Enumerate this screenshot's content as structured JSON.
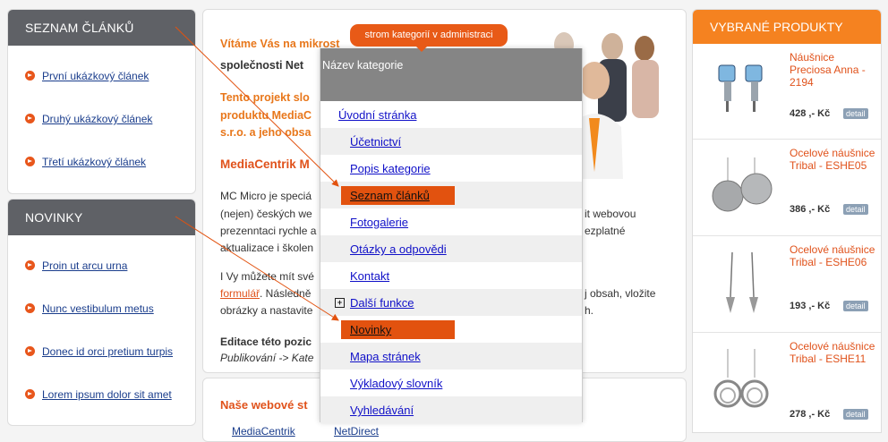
{
  "left": {
    "articles": {
      "title": "SEZNAM ČLÁNKŮ",
      "items": [
        "První ukázkový článek",
        "Druhý ukázkový článek",
        "Třetí ukázkový článek"
      ]
    },
    "news": {
      "title": "NOVINKY",
      "items": [
        "Proin ut arcu urna",
        "Nunc vestibulum metus",
        "Donec id orci pretium turpis",
        "Lorem ipsum dolor sit amet"
      ]
    }
  },
  "center": {
    "welcome_line1": "Vítáme Vás na mikrost",
    "welcome_line2": "společnosti Net",
    "project_line1": "Tento projekt slo",
    "project_line2": "produktu MediaC",
    "project_line3": "s.r.o. a jeho obsa",
    "heading": "MediaCentrik M",
    "p1_l1": "MC Micro je speciá",
    "p1_l1b": "it webovou",
    "p1_l2": "(nejen) českých we",
    "p1_l3": "prezenntaci rychle a",
    "p1_l3b": "ezplatné",
    "p1_l4": "aktualizace i školen",
    "p2_l1": "I Vy můžete mít své",
    "p2_l2_link": "formulář",
    "p2_l2": ". Následně",
    "p2_l2b": "j obsah, vložite",
    "p2_l3": "obrázky a nastavite",
    "p2_l3b": "h.",
    "edit_label": "Editace této pozic",
    "edit_path": "Publikování -> Kate",
    "bottom_heading": "Naše webové st",
    "bottom_link1": "MediaCentrik",
    "bottom_link2": "NetDirect"
  },
  "tooltip": "strom kategorií v administraci",
  "tree": {
    "header": "Název kategorie",
    "items": [
      {
        "label": "Úvodní stránka"
      },
      {
        "label": "Účetnictví"
      },
      {
        "label": "Popis kategorie"
      },
      {
        "label": "Seznam článků"
      },
      {
        "label": "Fotogalerie"
      },
      {
        "label": "Otázky a odpovědi"
      },
      {
        "label": "Kontakt"
      },
      {
        "label": "Další funkce"
      },
      {
        "label": "Novinky"
      },
      {
        "label": "Mapa stránek"
      },
      {
        "label": "Výkladový slovník"
      },
      {
        "label": "Vyhledávání"
      }
    ]
  },
  "right": {
    "title": "VYBRANÉ PRODUKTY",
    "products": [
      {
        "name": "Náušnice Preciosa Anna - 2194",
        "price": "428 ,- Kč",
        "detail": "detail"
      },
      {
        "name": "Ocelové náušnice Tribal - ESHE05",
        "price": "386 ,- Kč",
        "detail": "detail"
      },
      {
        "name": "Ocelové náušnice Tribal - ESHE06",
        "price": "193 ,- Kč",
        "detail": "detail"
      },
      {
        "name": "Ocelové náušnice Tribal - ESHE11",
        "price": "278 ,- Kč",
        "detail": "detail"
      }
    ]
  },
  "colors": {
    "accent": "#e8561b",
    "sidebar_header": "#5f6166",
    "products_header": "#f58220",
    "tree_header": "#858585"
  }
}
